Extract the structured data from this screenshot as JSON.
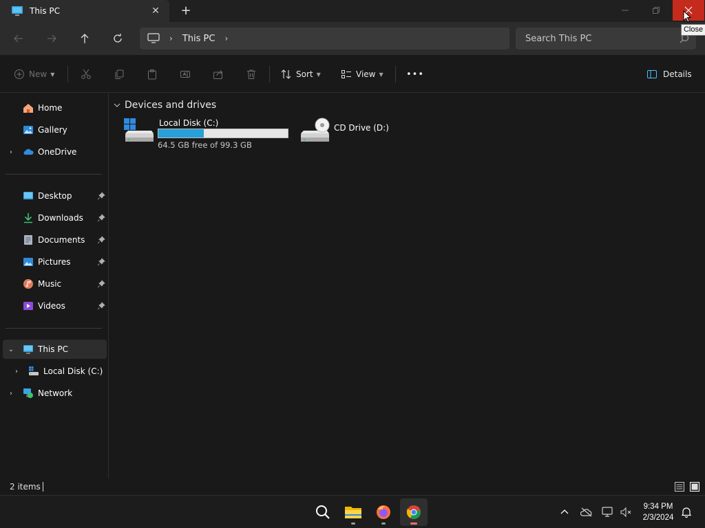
{
  "tab": {
    "title": "This PC",
    "close_glyph": "✕",
    "new_tab_glyph": "+"
  },
  "window_controls": {
    "minimize": "—",
    "maximize": "❐",
    "close": "✕",
    "tooltip": "Close"
  },
  "address_bar": {
    "crumbs": [
      "This PC"
    ],
    "separator": "›"
  },
  "search": {
    "placeholder": "Search This PC"
  },
  "commands": {
    "new_label": "New",
    "sort_label": "Sort",
    "view_label": "View",
    "more_label": "•••",
    "details_label": "Details"
  },
  "sidebar": {
    "quick": [
      {
        "label": "Home",
        "icon": "home-icon"
      },
      {
        "label": "Gallery",
        "icon": "gallery-icon"
      },
      {
        "label": "OneDrive",
        "icon": "onedrive-icon",
        "expandable": true
      }
    ],
    "pinned": [
      {
        "label": "Desktop",
        "icon": "desktop-icon"
      },
      {
        "label": "Downloads",
        "icon": "downloads-icon"
      },
      {
        "label": "Documents",
        "icon": "documents-icon"
      },
      {
        "label": "Pictures",
        "icon": "pictures-icon"
      },
      {
        "label": "Music",
        "icon": "music-icon"
      },
      {
        "label": "Videos",
        "icon": "videos-icon"
      }
    ],
    "tree": [
      {
        "label": "This PC",
        "icon": "this-pc-icon",
        "expanded": true,
        "selected": true
      },
      {
        "label": "Local Disk (C:)",
        "icon": "drive-icon"
      },
      {
        "label": "Network",
        "icon": "network-icon"
      }
    ]
  },
  "content": {
    "group_title": "Devices and drives",
    "drives": [
      {
        "name": "Local Disk (C:)",
        "free_text": "64.5 GB free of 99.3 GB",
        "used_fraction": 0.35,
        "icon": "windows-drive-icon"
      },
      {
        "name": "CD Drive (D:)",
        "icon": "cd-drive-icon"
      }
    ]
  },
  "status": {
    "item_count": "2 items"
  },
  "taskbar": {
    "apps": [
      "search-icon",
      "file-explorer-icon",
      "firefox-icon",
      "chrome-icon"
    ],
    "clock_time": "9:34 PM",
    "clock_date": "2/3/2024"
  },
  "colors": {
    "accent": "#26a0da",
    "close_red": "#c42b1c",
    "background": "#191919"
  }
}
